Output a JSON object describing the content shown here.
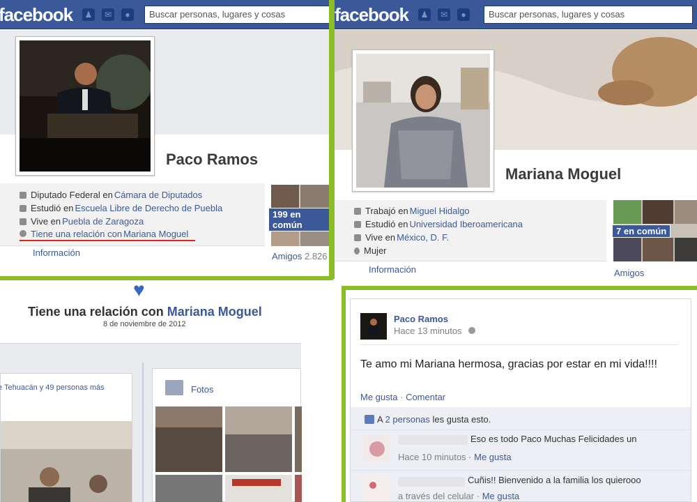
{
  "brand": {
    "logo": "facebook"
  },
  "search": {
    "placeholder": "Buscar personas, lugares y cosas"
  },
  "paco": {
    "name": "Paco Ramos",
    "info": [
      {
        "pre": "Diputado Federal en ",
        "link": "Cámara de Diputados"
      },
      {
        "pre": "Estudió en ",
        "link": "Escuela Libre de Derecho de Puebla"
      },
      {
        "pre": "Vive en ",
        "link": "Puebla de Zaragoza"
      },
      {
        "pre": "Tiene una relación con ",
        "link": "Mariana Moguel"
      }
    ],
    "info_link": "Información",
    "mutual_badge": "199 en común",
    "friends_label": "Amigos",
    "friends_count": "2.826"
  },
  "mariana": {
    "name": "Mariana Moguel",
    "info": [
      {
        "pre": "Trabajó en ",
        "link": "Miguel Hidalgo"
      },
      {
        "pre": "Estudió en ",
        "link": "Universidad Iberoamericana"
      },
      {
        "pre": "Vive en ",
        "link": "México, D. F."
      },
      {
        "pre": "Mujer",
        "link": ""
      }
    ],
    "info_link": "Información",
    "mutual_badge": "7 en común",
    "friends_label": "Amigos"
  },
  "relationship": {
    "title_pre": "Tiene una relación con ",
    "title_link": "Mariana Moguel",
    "date": "8 de noviembre de 2012",
    "snippet": "e Tehuacán y 49 personas más",
    "photos_label": "Fotos"
  },
  "post": {
    "author": "Paco Ramos",
    "time": "Hace 13 minutos",
    "text": "Te amo mi Mariana hermosa, gracias por estar en mi vida!!!!",
    "like": "Me gusta",
    "comment": "Comentar",
    "likes_pre": "A ",
    "likes_link": "2 personas",
    "likes_post": " les gusta esto.",
    "comments": [
      {
        "text": "Eso es todo Paco Muchas Felicidades un",
        "meta_time": "Hace 10 minutos",
        "meta_like": "Me gusta"
      },
      {
        "text": "Cuñis!! Bienvenido a la familia los quierooo",
        "meta_time": "a través del celular",
        "meta_like": "Me gusta"
      }
    ]
  },
  "colors": {
    "fb_blue": "#3b5998",
    "green": "#8cbf26",
    "red_underline": "#d9251c"
  }
}
